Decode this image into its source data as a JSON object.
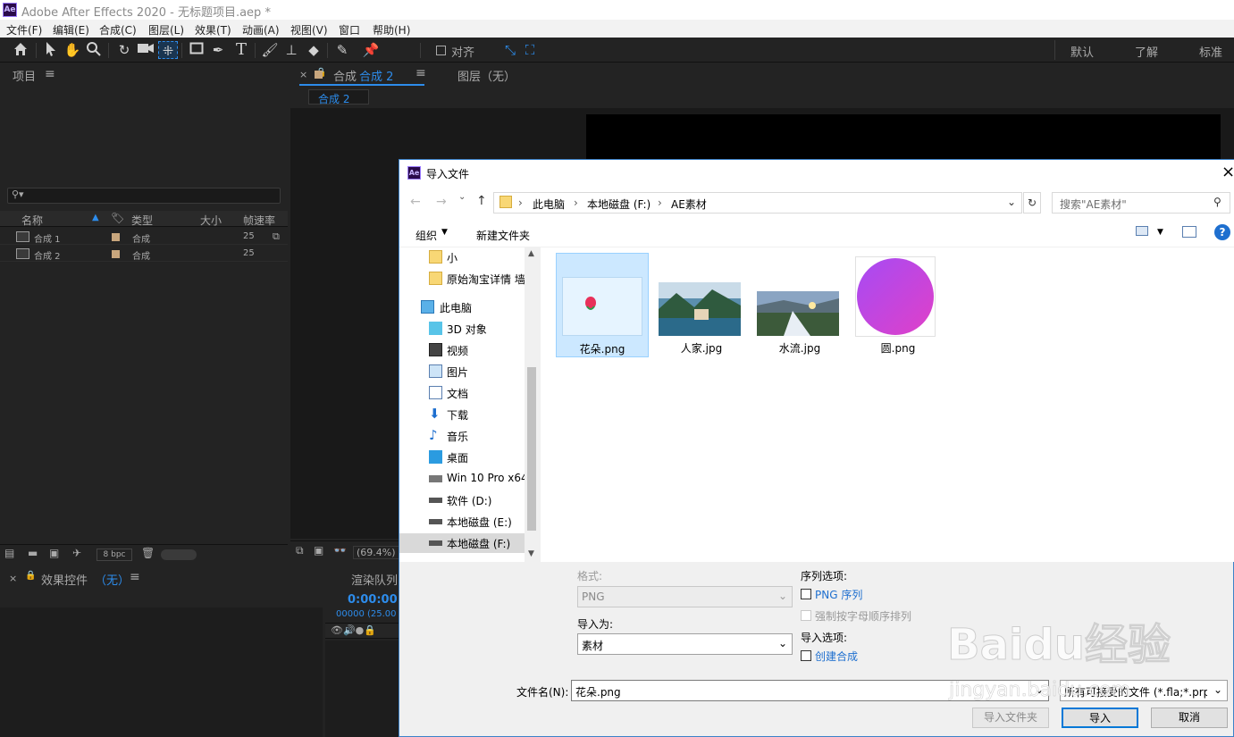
{
  "app": {
    "logo": "Ae",
    "window_title": "Adobe After Effects 2020 - 无标题项目.aep *"
  },
  "menu": [
    "文件(F)",
    "编辑(E)",
    "合成(C)",
    "图层(L)",
    "效果(T)",
    "动画(A)",
    "视图(V)",
    "窗口",
    "帮助(H)"
  ],
  "toolbar": {
    "snap_label": "对齐",
    "workspaces": [
      "默认",
      "了解",
      "标准"
    ]
  },
  "project_panel": {
    "title": "项目",
    "columns": {
      "name": "名称",
      "type": "类型",
      "size": "大小",
      "fps": "帧速率"
    },
    "rows": [
      {
        "name": "合成 1",
        "type": "合成",
        "fps": "25"
      },
      {
        "name": "合成 2",
        "type": "合成",
        "fps": "25"
      }
    ],
    "bpc": "8 bpc"
  },
  "comp_panel": {
    "tab_prefix": "合成",
    "tab_name": "合成 2",
    "layer_tab": "图层（无）",
    "breadcrumb": "合成 2",
    "zoom": "(69.4%)"
  },
  "effects_panel": {
    "title": "效果控件",
    "value": "（无）"
  },
  "render_panel": {
    "title": "渲染队列",
    "timecode": "0:00:00:",
    "frames": "00000 (25.00"
  },
  "dialog": {
    "title": "导入文件",
    "breadcrumb": [
      "此电脑",
      "本地磁盘 (F:)",
      "AE素材"
    ],
    "search_placeholder": "搜索\"AE素材\"",
    "organize": "组织",
    "new_folder": "新建文件夹",
    "nav_items": [
      {
        "label": "小",
        "icon": "folder-icon"
      },
      {
        "label": "原始淘宝详情 墙",
        "icon": "folder-icon"
      },
      {
        "label": "此电脑",
        "icon": "computer-icon"
      },
      {
        "label": "3D 对象",
        "icon": "cube-icon"
      },
      {
        "label": "视频",
        "icon": "video-icon"
      },
      {
        "label": "图片",
        "icon": "pictures-icon"
      },
      {
        "label": "文档",
        "icon": "documents-icon"
      },
      {
        "label": "下载",
        "icon": "download-icon"
      },
      {
        "label": "音乐",
        "icon": "music-icon"
      },
      {
        "label": "桌面",
        "icon": "desktop-icon"
      },
      {
        "label": "Win 10 Pro x64",
        "icon": "drive-icon"
      },
      {
        "label": "软件 (D:)",
        "icon": "drive-icon"
      },
      {
        "label": "本地磁盘 (E:)",
        "icon": "drive-icon"
      },
      {
        "label": "本地磁盘 (F:)",
        "icon": "drive-icon"
      }
    ],
    "files": [
      {
        "name": "花朵.png",
        "selected": true
      },
      {
        "name": "人家.jpg",
        "selected": false
      },
      {
        "name": "水流.jpg",
        "selected": false
      },
      {
        "name": "圆.png",
        "selected": false
      }
    ],
    "format_label": "格式:",
    "format_value": "PNG",
    "import_as_label": "导入为:",
    "import_as_value": "素材",
    "sequence_label": "序列选项:",
    "png_sequence": "PNG 序列",
    "force_alpha": "强制按字母顺序排列",
    "import_options_label": "导入选项:",
    "create_comp": "创建合成",
    "filename_label": "文件名(N):",
    "filename_value": "花朵.png",
    "filter_value": "所有可接受的文件 (*.fla;*.prpr",
    "btn_import_folder": "导入文件夹",
    "btn_import": "导入",
    "btn_cancel": "取消"
  },
  "watermark": {
    "text": "Baidu经验",
    "url": "jingyan.baidu.com"
  },
  "colors": {
    "accent": "#2d8ceb",
    "selection": "#cce8ff",
    "panel_bg": "#232323",
    "dialog_border": "#3c82c8"
  }
}
